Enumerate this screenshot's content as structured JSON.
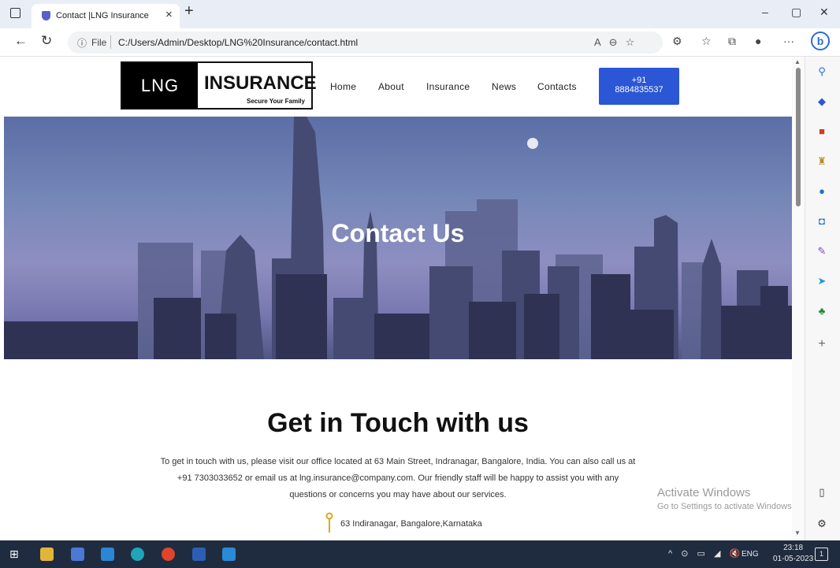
{
  "browser": {
    "tab_title": "Contact |LNG Insurance",
    "tab_close": "×",
    "new_tab": "+",
    "url_info_icon": "ⓘ",
    "url_scheme": "File",
    "url": "C:/Users/Admin/Desktop/LNG%20Insurance/contact.html",
    "window_controls": [
      "–",
      "▢",
      "✕"
    ],
    "icons": [
      "back-icon",
      "refresh-icon",
      "read-aloud-icon",
      "zoom-icon",
      "favorite-icon",
      "extensions-icon",
      "favorites-icon",
      "collections-icon",
      "profile-icon",
      "more-icon",
      "bing-icon"
    ],
    "bing_label": "b",
    "more_label": "···"
  },
  "sidebar": {
    "icons": [
      "search-icon",
      "tag-icon",
      "shopping-icon",
      "chess-icon",
      "office-icon",
      "outlook-icon",
      "designer-icon",
      "send-icon",
      "tree-icon",
      "add-icon",
      "split-screen-icon",
      "settings-icon"
    ]
  },
  "site": {
    "logo": {
      "left": "LNG",
      "main": "INSURANCE",
      "tagline": "Secure Your Family"
    },
    "menu": [
      {
        "label": "Home"
      },
      {
        "label": "About"
      },
      {
        "label": "Insurance"
      },
      {
        "label": "News"
      },
      {
        "label": "Contacts"
      }
    ],
    "phone": {
      "line1": "+91",
      "line2": "8884835537"
    },
    "hero_title": "Contact Us",
    "section_title": "Get in Touch with us",
    "section_text": "To get in touch with us, please visit our office located at 63 Main Street, Indranagar, Bangalore, India. You can also call us at +91 7303033652 or email us at lng.insurance@company.com. Our friendly staff will be happy to assist you with any questions or concerns you may have about our services.",
    "address": "63 Indiranagar, Bangalore,Karnataka"
  },
  "watermark": {
    "line1": "Activate Windows",
    "line2": "Go to Settings to activate Windows."
  },
  "taskbar": {
    "apps": [
      "start-icon",
      "file-explorer-icon",
      "store-icon",
      "mail-icon",
      "edge-icon",
      "chrome-icon",
      "word-icon",
      "vscode-icon"
    ],
    "tray": "^ ⊙ ▭ ◢ 🔇",
    "language": "ENG",
    "time": "23:18",
    "date": "01-05-2023",
    "notification_count": "1"
  },
  "colors": {
    "accent_button": "#2b57d6",
    "taskbar": "#1f2c3f",
    "tab_bar": "#e9eef6"
  }
}
